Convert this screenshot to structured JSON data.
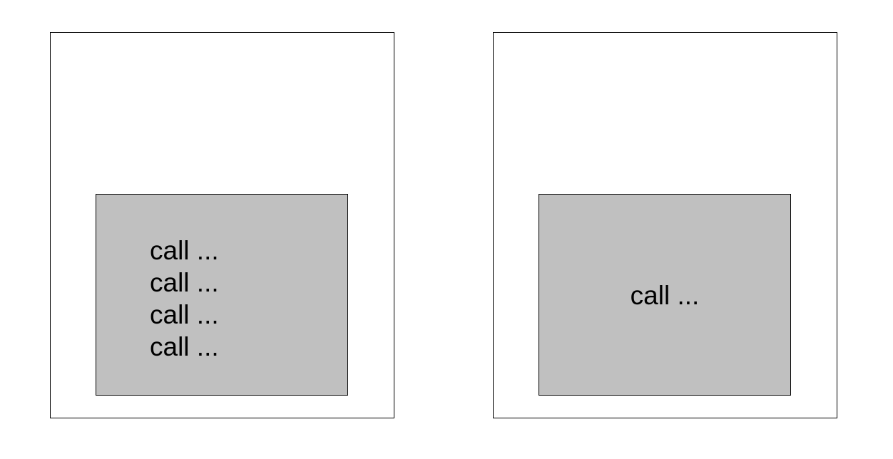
{
  "left_panel": {
    "calls": [
      "call ...",
      "call ...",
      "call ...",
      "call ..."
    ]
  },
  "right_panel": {
    "call": "call ..."
  }
}
